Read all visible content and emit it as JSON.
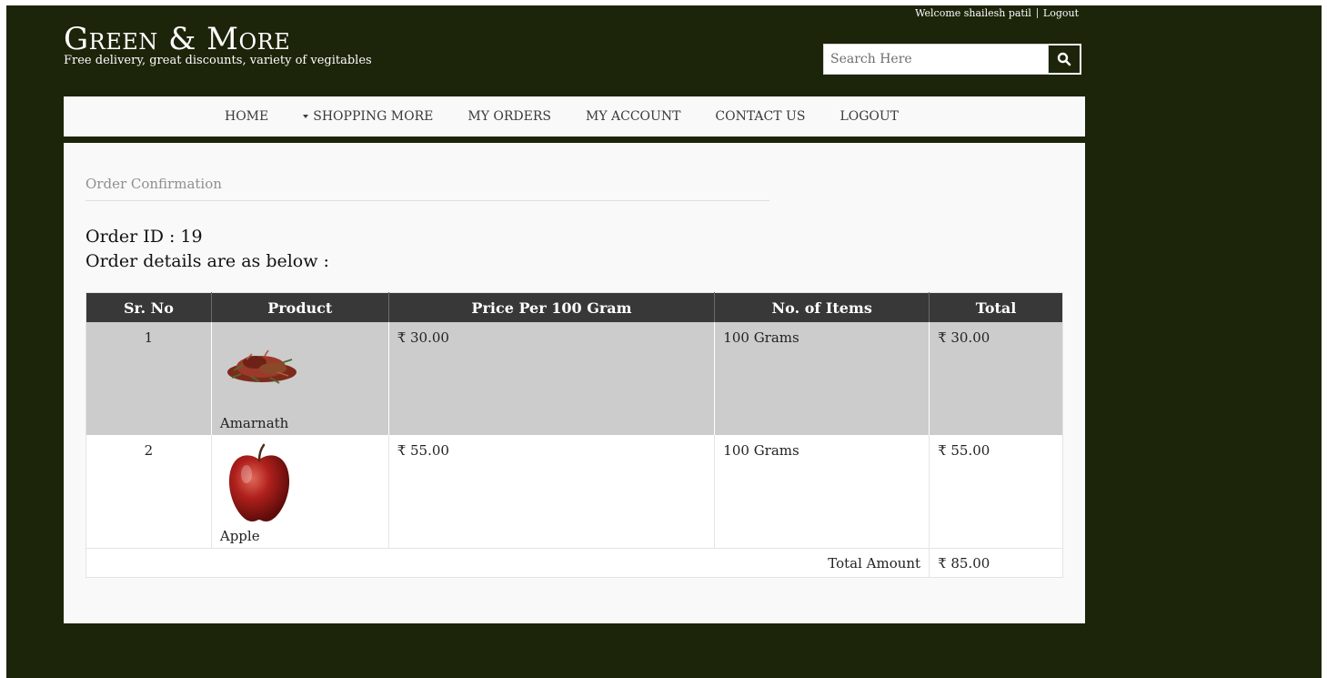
{
  "header": {
    "welcome_text": "Welcome shailesh patil",
    "logout_link": "Logout",
    "brand_name": "Green & More",
    "tagline": "Free delivery, great discounts, variety of vegitables",
    "search_placeholder": "Search Here",
    "search_icon": "search-icon"
  },
  "nav": {
    "items": [
      "HOME",
      "SHOPPING MORE",
      "MY ORDERS",
      "MY ACCOUNT",
      "CONTACT US",
      "LOGOUT"
    ]
  },
  "main": {
    "section_title": "Order Confirmation",
    "order_id_text": "Order ID : 19",
    "order_note": "Order details are as below :",
    "table": {
      "columns": [
        "Sr. No",
        "Product",
        "Price Per 100 Gram",
        "No. of Items",
        "Total"
      ],
      "rows": [
        {
          "sr": "1",
          "product": "Amarnath",
          "price": "₹ 30.00",
          "qty": "100 Grams",
          "total": "₹ 30.00"
        },
        {
          "sr": "2",
          "product": "Apple",
          "price": "₹ 55.00",
          "qty": "100 Grams",
          "total": "₹ 55.00"
        }
      ],
      "total_label": "Total Amount",
      "total_value": "₹ 85.00"
    }
  },
  "colors": {
    "page_background": "#1c2409",
    "header_row": "#383838",
    "odd_row": "#cccccc"
  }
}
